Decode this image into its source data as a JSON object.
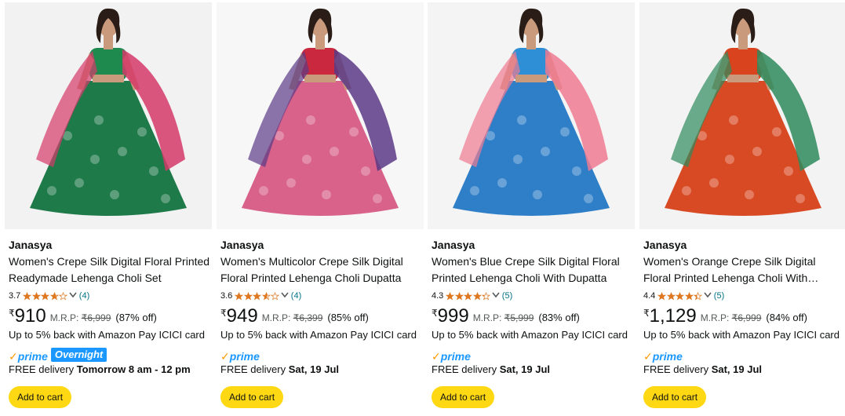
{
  "products": [
    {
      "brand": "Janasya",
      "title": "Women's Crepe Silk Digital Floral Printed Readymade Lehenga Choli Set",
      "rating": "3.7",
      "stars": 3.7,
      "reviews": "(4)",
      "currency": "₹",
      "price": "910",
      "mrp_label": "M.R.P:",
      "mrp": "₹6,999",
      "discount": "(87% off)",
      "cashback": "Up to 5% back with Amazon Pay ICICI card",
      "prime": "prime",
      "badge": "Overnight",
      "delivery_prefix": "FREE delivery ",
      "delivery_date": "Tomorrow 8 am - 12 pm",
      "cart": "Add to cart",
      "image": {
        "icon": "lehenga-green-photo",
        "blouse": "#1E8A4E",
        "skirt": "#1F7A4A",
        "dupatta": "#D63A6A",
        "bg": "#f2f2f2"
      }
    },
    {
      "brand": "Janasya",
      "title": "Women's Multicolor Crepe Silk Digital Floral Printed Lehenga Choli Dupatta",
      "rating": "3.6",
      "stars": 3.6,
      "reviews": "(4)",
      "currency": "₹",
      "price": "949",
      "mrp_label": "M.R.P:",
      "mrp": "₹6,399",
      "discount": "(85% off)",
      "cashback": "Up to 5% back with Amazon Pay ICICI card",
      "prime": "prime",
      "badge": "",
      "delivery_prefix": "FREE delivery ",
      "delivery_date": "Sat, 19 Jul",
      "cart": "Add to cart",
      "image": {
        "icon": "lehenga-multicolor-photo",
        "blouse": "#C9283E",
        "skirt": "#D8628A",
        "dupatta": "#5A3A86",
        "bg": "#f7f7f7"
      }
    },
    {
      "brand": "Janasya",
      "title": "Women's Blue Crepe Silk Digital Floral Printed Lehenga Choli With Dupatta",
      "rating": "4.3",
      "stars": 4.3,
      "reviews": "(5)",
      "currency": "₹",
      "price": "999",
      "mrp_label": "M.R.P:",
      "mrp": "₹5,999",
      "discount": "(83% off)",
      "cashback": "Up to 5% back with Amazon Pay ICICI card",
      "prime": "prime",
      "badge": "",
      "delivery_prefix": "FREE delivery ",
      "delivery_date": "Sat, 19 Jul",
      "cart": "Add to cart",
      "image": {
        "icon": "lehenga-blue-photo",
        "blouse": "#2E8FD6",
        "skirt": "#2F7FC8",
        "dupatta": "#F07A92",
        "bg": "#f4f4f4"
      }
    },
    {
      "brand": "Janasya",
      "title": "Women's Orange Crepe Silk Digital Floral Printed Lehenga Choli With…",
      "rating": "4.4",
      "stars": 4.4,
      "reviews": "(5)",
      "currency": "₹",
      "price": "1,129",
      "mrp_label": "M.R.P:",
      "mrp": "₹6,999",
      "discount": "(84% off)",
      "cashback": "Up to 5% back with Amazon Pay ICICI card",
      "prime": "prime",
      "badge": "",
      "delivery_prefix": "FREE delivery ",
      "delivery_date": "Sat, 19 Jul",
      "cart": "Add to cart",
      "image": {
        "icon": "lehenga-orange-photo",
        "blouse": "#D9431E",
        "skirt": "#D84A24",
        "dupatta": "#2E8A5C",
        "bg": "#f3f3f3"
      }
    }
  ],
  "colors": {
    "link": "#007185",
    "star": "#DE7921",
    "prime_blue": "#1A98FF",
    "prime_orange": "#FF9900",
    "button": "#FFD814"
  }
}
